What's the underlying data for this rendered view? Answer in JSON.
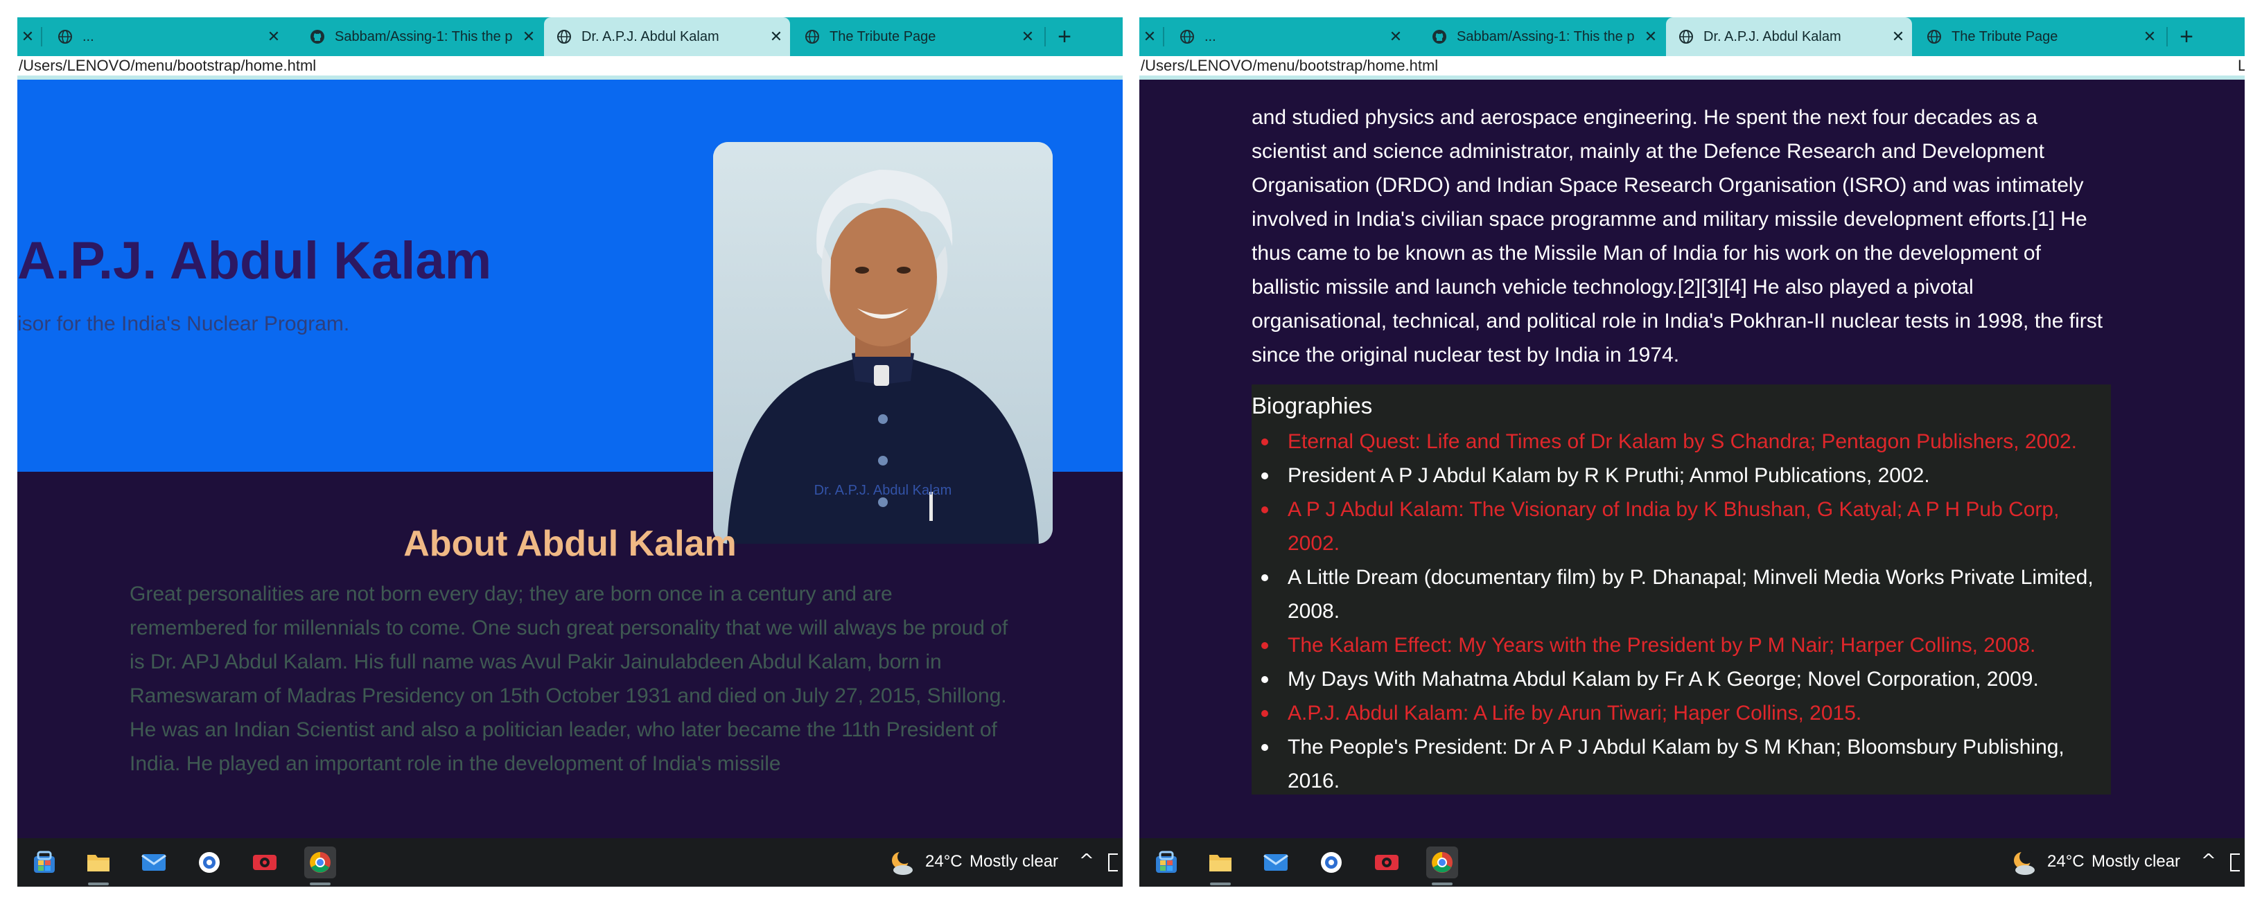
{
  "screens": [
    {
      "tabs": [
        {
          "title": "",
          "has_close": true
        },
        {
          "title": "...",
          "has_close": true
        },
        {
          "title": "Sabbam/Assing-1: This the p",
          "has_close": true
        },
        {
          "title": "Dr. A.P.J. Abdul Kalam",
          "has_close": true,
          "active": true
        },
        {
          "title": "The Tribute Page",
          "has_close": true
        }
      ],
      "new_tab": "+",
      "address": "/Users/LENOVO/menu/bootstrap/home.html",
      "address_overflow": ""
    },
    {
      "tabs": [
        {
          "title": "",
          "has_close": true
        },
        {
          "title": "...",
          "has_close": true
        },
        {
          "title": "Sabbam/Assing-1: This the p",
          "has_close": true
        },
        {
          "title": "Dr. A.P.J. Abdul Kalam",
          "has_close": true,
          "active": true
        },
        {
          "title": "The Tribute Page",
          "has_close": true
        }
      ],
      "new_tab": "+",
      "address": "/Users/LENOVO/menu/bootstrap/home.html",
      "address_overflow": "L"
    }
  ],
  "hero": {
    "title": "A.P.J. Abdul Kalam",
    "subtitle": "isor for the India's Nuclear Program.",
    "photo_caption": "Dr. A.P.J. Abdul Kalam"
  },
  "about": {
    "title": "About Abdul Kalam",
    "text": "Great personalities are not born every day; they are born once in a century and are remembered for millennials to come. One such great personality that we will always be proud of is Dr. APJ Abdul Kalam. His full name was Avul Pakir Jainulabdeen Abdul Kalam, born in Rameswaram of Madras Presidency on 15th October 1931 and died on July 27, 2015, Shillong. He was an Indian Scientist and also a politician leader, who later became the 11th President of India. He played an important role in the development of India's missile"
  },
  "bio": {
    "text": "and studied physics and aerospace engineering. He spent the next four decades as a scientist and science administrator, mainly at the Defence Research and Development Organisation (DRDO) and Indian Space Research Organisation (ISRO) and was intimately involved in India's civilian space programme and military missile development efforts.[1] He thus came to be known as the Missile Man of India for his work on the development of ballistic missile and launch vehicle technology.[2][3][4] He also played a pivotal organisational, technical, and political role in India's Pokhran-II nuclear tests in 1998, the first since the original nuclear test by India in 1974.",
    "heading": "Biographies",
    "items": [
      {
        "text": "Eternal Quest: Life and Times of Dr Kalam by S Chandra; Pentagon Publishers, 2002.",
        "color": "red"
      },
      {
        "text": "President A P J Abdul Kalam by R K Pruthi; Anmol Publications, 2002.",
        "color": "white"
      },
      {
        "text": "A P J Abdul Kalam: The Visionary of India by K Bhushan, G Katyal; A P H Pub Corp, 2002.",
        "color": "red"
      },
      {
        "text": "A Little Dream (documentary film) by P. Dhanapal; Minveli Media Works Private Limited, 2008.",
        "color": "white"
      },
      {
        "text": "The Kalam Effect: My Years with the President by P M Nair; Harper Collins, 2008.",
        "color": "red"
      },
      {
        "text": "My Days With Mahatma Abdul Kalam by Fr A K George; Novel Corporation, 2009.",
        "color": "white"
      },
      {
        "text": "A.P.J. Abdul Kalam: A Life by Arun Tiwari; Haper Collins, 2015.",
        "color": "red"
      },
      {
        "text": "The People's President: Dr A P J Abdul Kalam by S M Khan; Bloomsbury Publishing, 2016.",
        "color": "white"
      }
    ]
  },
  "taskbar": {
    "icons": [
      "start-icon",
      "file-explorer-icon",
      "mail-icon",
      "app-icon",
      "camera-app-icon",
      "chrome-icon"
    ],
    "weather_temp": "24°C",
    "weather_desc": "Mostly clear",
    "tray_chevron": "^"
  },
  "colors": {
    "tab_strip": "#0fb0b6",
    "active_tab": "#bfe9ea",
    "hero_bg": "#0a69f0",
    "page_bg": "#1e0f3a",
    "hero_title": "#2c1862",
    "about_title": "#f0b985",
    "link_red": "#e0272b",
    "bio_box_bg": "#1f2220"
  }
}
